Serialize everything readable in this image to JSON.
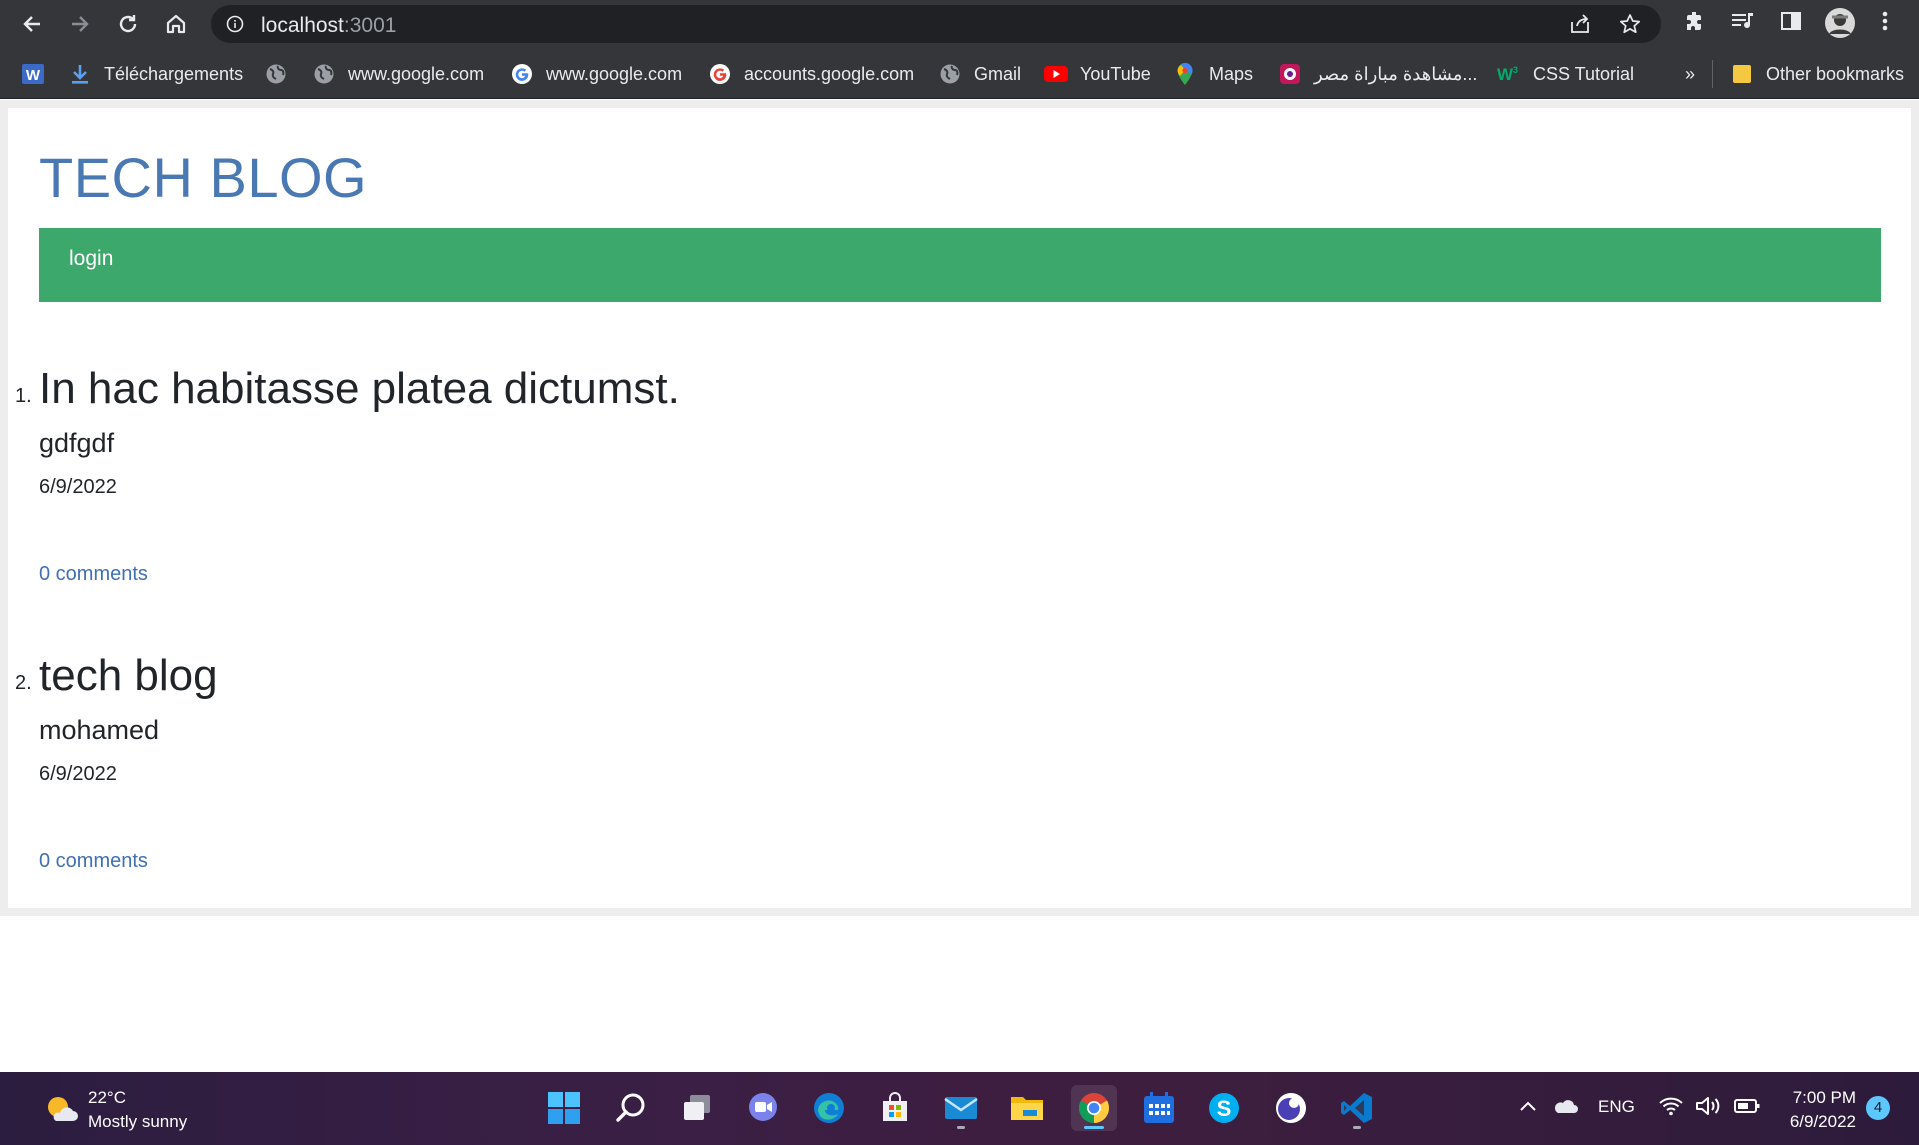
{
  "browser": {
    "url_host": "localhost",
    "url_port": ":3001",
    "bookmarks": [
      {
        "label": "",
        "icon": "word-icon"
      },
      {
        "label": "Téléchargements",
        "icon": "download-icon"
      },
      {
        "label": "",
        "icon": "globe-icon"
      },
      {
        "label": "www.google.com",
        "icon": "globe-icon"
      },
      {
        "label": "www.google.com",
        "icon": "google-icon"
      },
      {
        "label": "accounts.google.com",
        "icon": "google-icon"
      },
      {
        "label": "Gmail",
        "icon": "globe-icon"
      },
      {
        "label": "YouTube",
        "icon": "youtube-icon"
      },
      {
        "label": "Maps",
        "icon": "maps-icon"
      },
      {
        "label": "مشاهدة مباراة مصر...",
        "icon": "site-icon"
      },
      {
        "label": "CSS Tutorial",
        "icon": "w3-icon"
      }
    ],
    "more_bookmarks": "»",
    "other_bookmarks": "Other bookmarks"
  },
  "site": {
    "title": "TECH BLOG",
    "nav_login": "login"
  },
  "posts": [
    {
      "number": "1.",
      "title": "In hac habitasse platea dictumst.",
      "author": "gdfgdf",
      "date": "6/9/2022",
      "comments": "0 comments"
    },
    {
      "number": "2.",
      "title": "tech blog",
      "author": "mohamed",
      "date": "6/9/2022",
      "comments": "0 comments"
    }
  ],
  "taskbar": {
    "weather_temp": "22°C",
    "weather_desc": "Mostly sunny",
    "language": "ENG",
    "time": "7:00 PM",
    "date": "6/9/2022",
    "notifications": "4",
    "apps": [
      "start",
      "search",
      "task-view",
      "teams",
      "edge",
      "store",
      "mail",
      "file-explorer",
      "chrome",
      "calendar",
      "skype",
      "app",
      "vscode"
    ]
  },
  "colors": {
    "title_blue": "#4a78b3",
    "navbar_green": "#3ca86c",
    "link_blue": "#3f70b4",
    "chrome_dark": "#35363a"
  }
}
